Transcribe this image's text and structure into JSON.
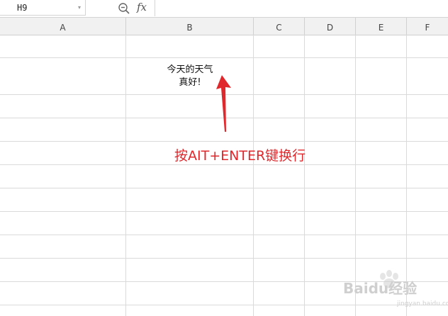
{
  "formula_bar": {
    "name_box_value": "H9",
    "fx_label": "fx",
    "formula_value": ""
  },
  "columns": [
    "A",
    "B",
    "C",
    "D",
    "E",
    "F"
  ],
  "cell_b": {
    "line1": "今天的天气",
    "line2": "真好!"
  },
  "annotation": {
    "text": "按AIT+ENTER键换行",
    "color": "#e0282c"
  },
  "watermark": {
    "brand": "Bai",
    "suffix": "经验",
    "sub": "jingyan.baidu.com"
  },
  "colors": {
    "grid": "#dadada",
    "header_bg": "#f1f1f1",
    "arrow": "#e0282c"
  }
}
